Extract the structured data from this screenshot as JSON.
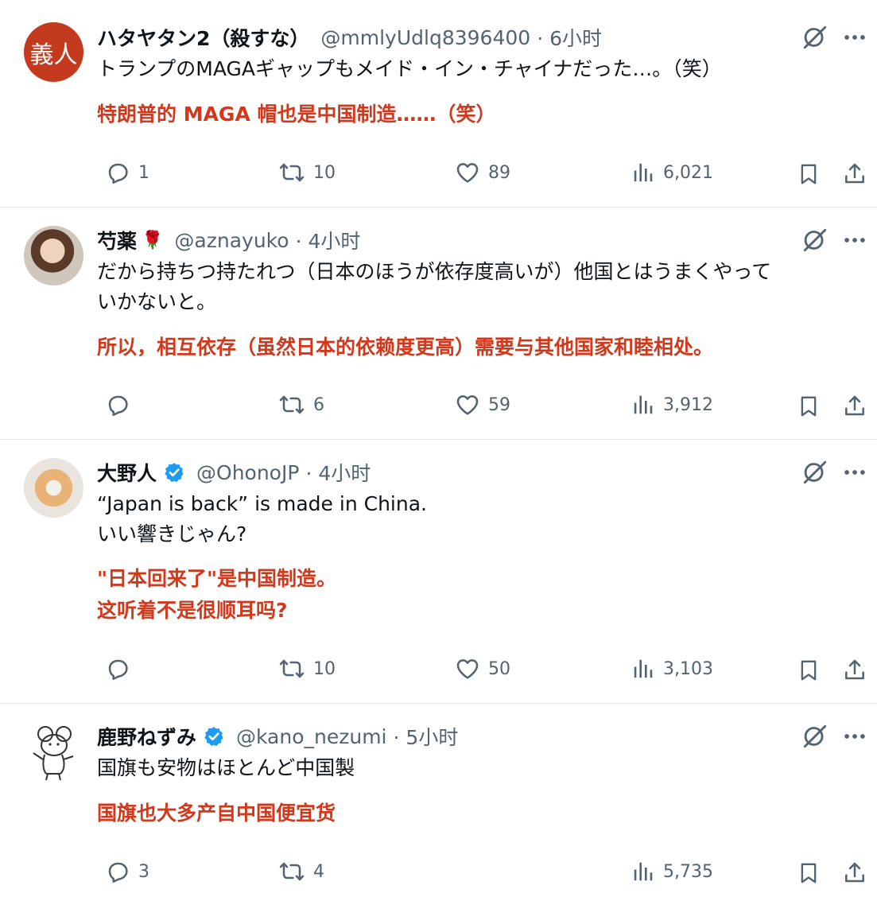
{
  "tweets": [
    {
      "avatar_text": "義人",
      "name": "ハタヤタン2（殺すな）",
      "handle": "@mmlyUdlq8396400",
      "time": "· 6小时",
      "text": "トランプのMAGAギャップもメイド・イン・チャイナだった…。（笑）",
      "translation": "特朗普的 MAGA 帽也是中国制造……（笑）",
      "replies": "1",
      "retweets": "10",
      "likes": "89",
      "views": "6,021"
    },
    {
      "name": "芍薬",
      "handle": "@aznayuko",
      "time": "· 4小时",
      "text": "だから持ちつ持たれつ（日本のほうが依存度高いが）他国とはうまくやって\nいかないと。",
      "translation": "所以，相互依存（虽然日本的依赖度更高）需要与其他国家和睦相处。",
      "replies": "",
      "retweets": "6",
      "likes": "59",
      "views": "3,912"
    },
    {
      "name": "大野人",
      "handle": "@OhonoJP",
      "time": "· 4小时",
      "text": "“Japan is back” is made in China.\nいい響きじゃん?",
      "translation": "\"日本回来了\"是中国制造。\n这听着不是很顺耳吗?",
      "replies": "",
      "retweets": "10",
      "likes": "50",
      "views": "3,103"
    },
    {
      "name": "鹿野ねずみ",
      "handle": "@kano_nezumi",
      "time": "· 5小时",
      "text": "国旗も安物はほとんど中国製",
      "translation": "国旗也大多产自中国便宜货",
      "replies": "3",
      "retweets": "4",
      "likes": "",
      "views": "5,735"
    }
  ],
  "colors": {
    "translation": "#d2381b",
    "secondary": "#536471",
    "verified": "#1d9bf0"
  },
  "icons": [
    "reply-icon",
    "retweet-icon",
    "like-icon",
    "views-icon",
    "bookmark-icon",
    "share-icon",
    "grok-icon",
    "more-icon",
    "verified-icon",
    "rose-emoji"
  ]
}
